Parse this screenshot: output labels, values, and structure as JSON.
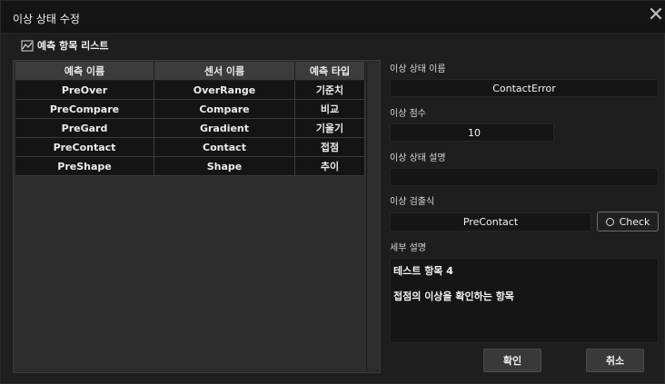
{
  "window": {
    "title": "이상 상태 수정"
  },
  "list": {
    "title": "예측 항목 리스트",
    "columns": [
      "예측 이름",
      "센서 이름",
      "예측 타입"
    ],
    "rows": [
      [
        "PreOver",
        "OverRange",
        "기준치"
      ],
      [
        "PreCompare",
        "Compare",
        "비교"
      ],
      [
        "PreGard",
        "Gradient",
        "기울기"
      ],
      [
        "PreContact",
        "Contact",
        "접점"
      ],
      [
        "PreShape",
        "Shape",
        "추이"
      ]
    ]
  },
  "form": {
    "name_label": "이상 상태 이름",
    "name_value": "ContactError",
    "score_label": "이상 점수",
    "score_value": "10",
    "state_desc_label": "이상 상태 설명",
    "state_desc_value": "",
    "expr_label": "이상 검출식",
    "expr_value": "PreContact",
    "check_label": "Check",
    "detail_label": "세부 설명",
    "detail_line1": "테스트 항목 4",
    "detail_line2": "접점의 이상을 확인하는 항목"
  },
  "buttons": {
    "ok": "확인",
    "cancel": "취소"
  },
  "icons": {
    "list": "chart-list-icon",
    "close": "close-icon",
    "check": "radio-circle-icon"
  }
}
